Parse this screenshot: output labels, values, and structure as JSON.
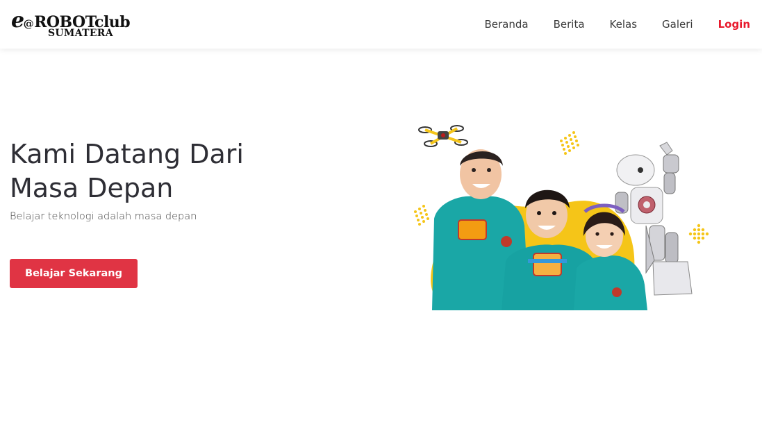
{
  "brand": {
    "logo_e": "e",
    "logo_at": "@",
    "logo_main": "ROBOTclub",
    "logo_sub": "SUMATERA"
  },
  "nav": {
    "items": [
      "Beranda",
      "Berita",
      "Kelas",
      "Galeri"
    ],
    "login": "Login"
  },
  "hero": {
    "title_line1": "Kami Datang Dari",
    "title_line2": "Masa Depan",
    "subtitle": "Belajar teknologi adalah masa depan",
    "cta_label": "Belajar Sekarang"
  },
  "colors": {
    "accent": "#e03444",
    "login": "#e8192c",
    "blob_yellow": "#f5c518",
    "uniform_teal": "#1aa7a6"
  }
}
